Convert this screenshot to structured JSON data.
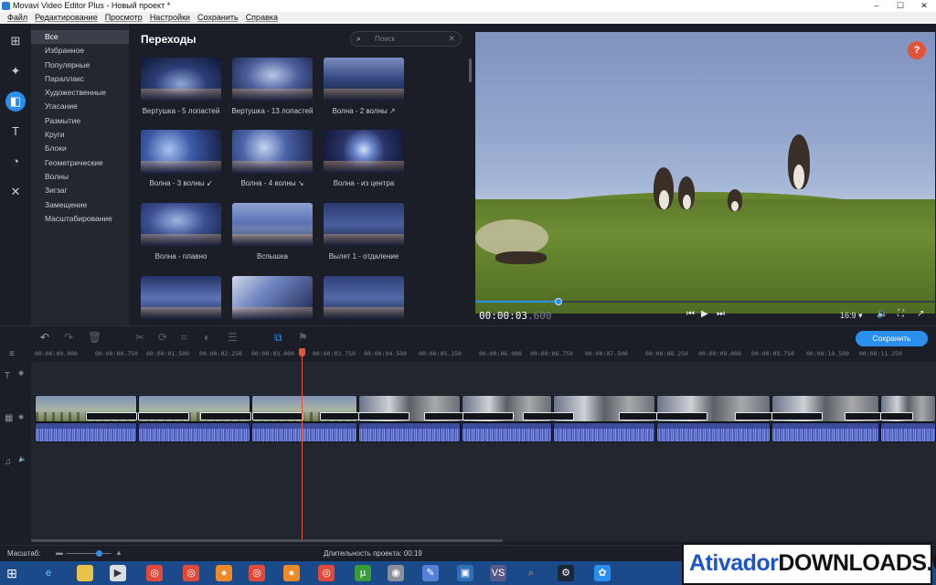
{
  "window": {
    "title": "Movavi Video Editor Plus - Новый проект *",
    "controls": [
      "–",
      "☐",
      "✕"
    ]
  },
  "menu": [
    "Файл",
    "Редактирование",
    "Просмотр",
    "Настройки",
    "Сохранить",
    "Справка"
  ],
  "toolbar_icons": [
    "import-icon",
    "magic-wand-icon",
    "transitions-icon",
    "titles-icon",
    "filters-icon",
    "tools-icon"
  ],
  "categories": {
    "items": [
      "Все",
      "Избранное",
      "Популярные",
      "Параллакс",
      "Художественные",
      "Угасание",
      "Размытие",
      "Круги",
      "Блоки",
      "Геометрические",
      "Волны",
      "Зигзаг",
      "Замещение",
      "Масштабирование"
    ],
    "selected": "Все"
  },
  "transitions": {
    "title": "Переходы",
    "search_placeholder": "Поиск",
    "items": [
      {
        "label": "Вертушка - 5 лопастей"
      },
      {
        "label": "Вертушка - 13 лопастей"
      },
      {
        "label": "Волна - 2 волны ↗"
      },
      {
        "label": "Волна - 3 волны ↙"
      },
      {
        "label": "Волна - 4 волны ↘"
      },
      {
        "label": "Волна - из центра"
      },
      {
        "label": "Волна - плавно"
      },
      {
        "label": "Вспышка"
      },
      {
        "label": "Вылет 1 - отдаление"
      },
      {
        "label": ""
      },
      {
        "label": ""
      },
      {
        "label": ""
      }
    ]
  },
  "preview": {
    "help": "?",
    "timecode_main": "00:00:03",
    "timecode_ms": ".600",
    "aspect": "16:9 ▾",
    "progress": 0.18
  },
  "timeline": {
    "save_label": "Сохранить",
    "ruler": [
      "00:00:00.000",
      "00:00:00.750",
      "00:00:01.500",
      "00:00:02.250",
      "00:00:03.000",
      "00:00:03.750",
      "00:00:04.500",
      "00:00:05.250",
      "00:00:06.000",
      "00:00:06.750",
      "00:00:07.500",
      "00:00:08.250",
      "00:00:09.000",
      "00:00:09.750",
      "00:00:10.500",
      "00:00:11.250"
    ]
  },
  "status": {
    "zoom_label": "Масштаб:",
    "zoom_level": 0.72,
    "duration_label": "Длительность проекта:",
    "duration_value": "00:19"
  },
  "watermark": {
    "part1": "Ativador",
    "part2": "DOWNLOADS.COM"
  }
}
